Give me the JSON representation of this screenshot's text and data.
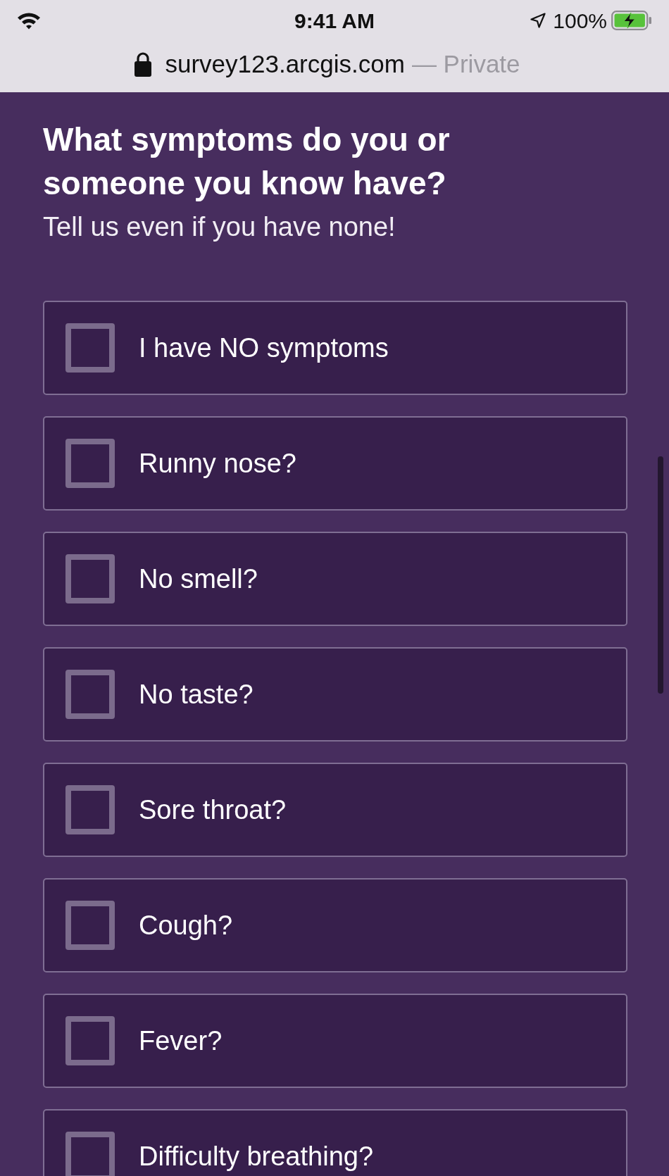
{
  "status_bar": {
    "time": "9:41 AM",
    "battery": "100%"
  },
  "address_bar": {
    "url": "survey123.arcgis.com",
    "mode": "— Private"
  },
  "question": {
    "title": "What symptoms do you or someone you know have?",
    "hint": "Tell us even if you have none!"
  },
  "options": [
    {
      "label": "I have NO symptoms",
      "checked": false
    },
    {
      "label": "Runny nose?",
      "checked": false
    },
    {
      "label": "No smell?",
      "checked": false
    },
    {
      "label": "No taste?",
      "checked": false
    },
    {
      "label": "Sore throat?",
      "checked": false
    },
    {
      "label": "Cough?",
      "checked": false
    },
    {
      "label": "Fever?",
      "checked": false
    },
    {
      "label": "Difficulty breathing?",
      "checked": false
    }
  ]
}
